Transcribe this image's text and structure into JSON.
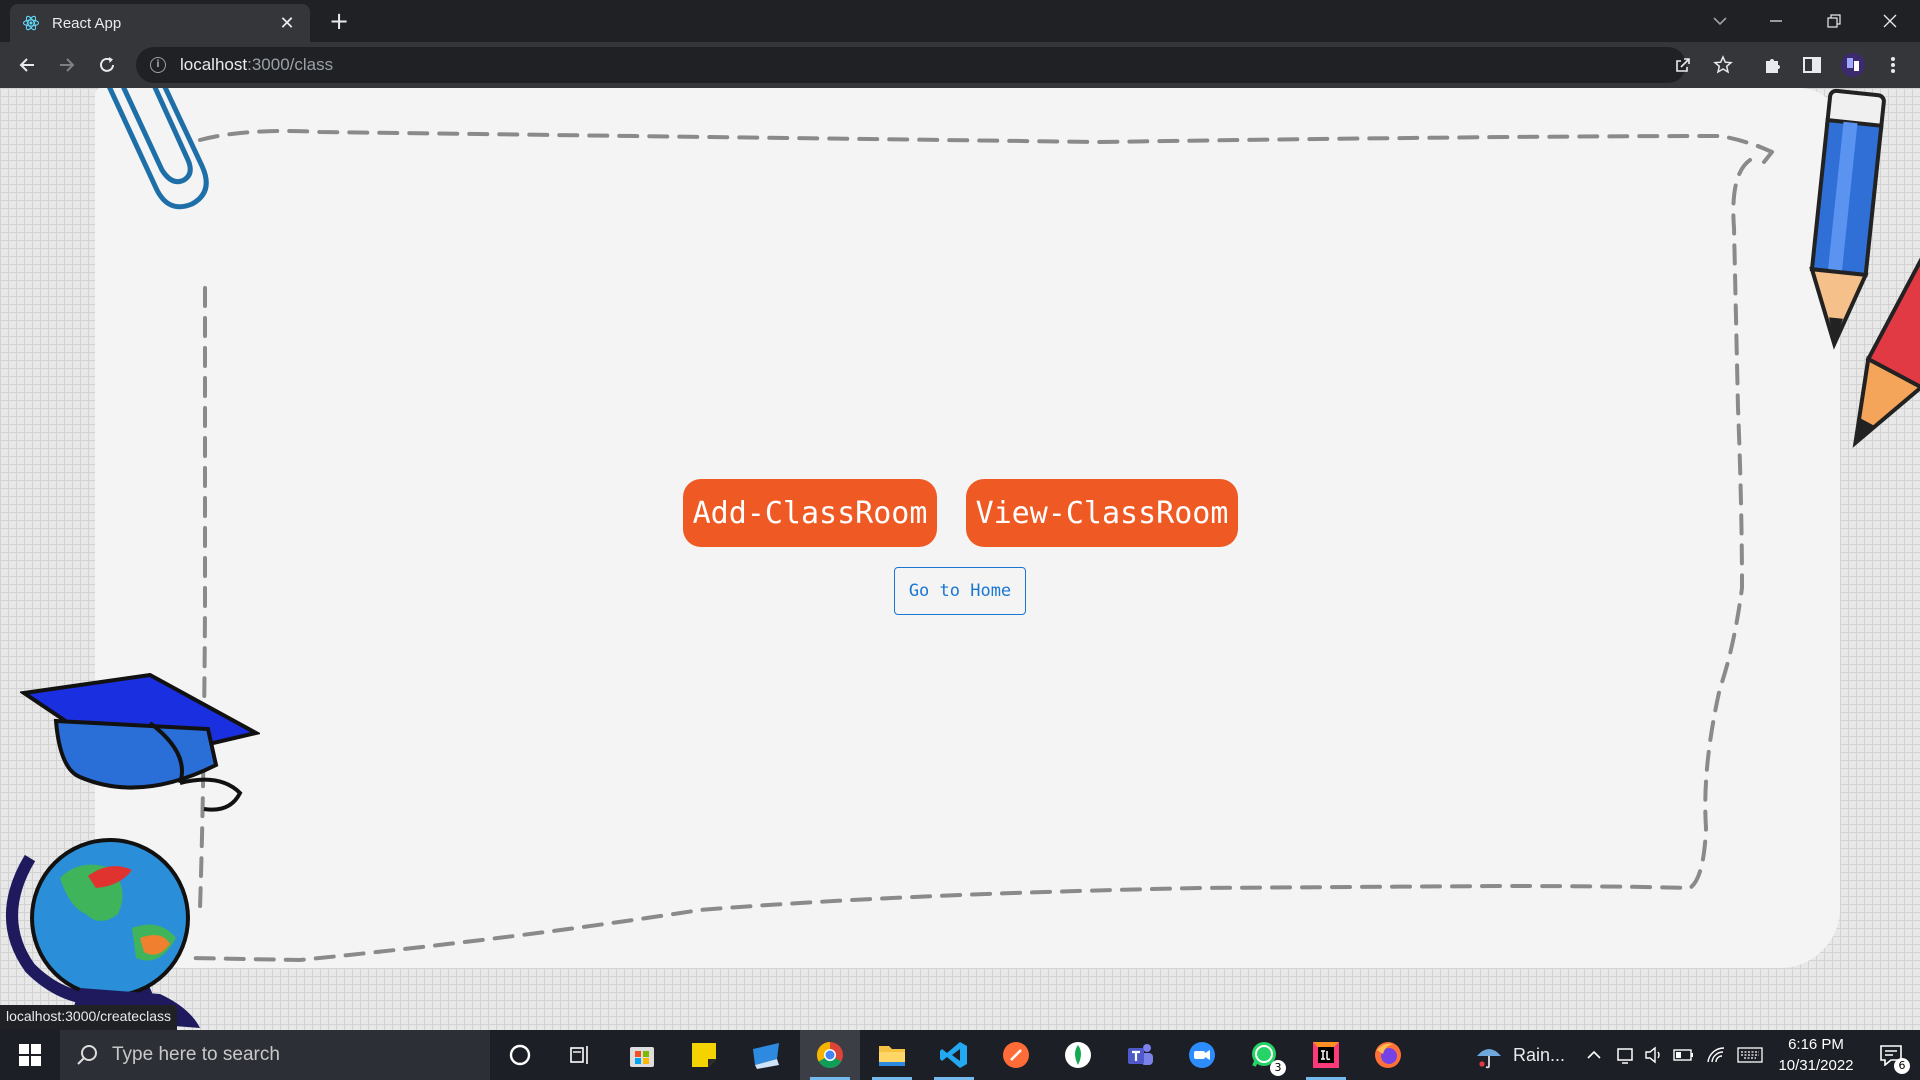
{
  "browser": {
    "tab": {
      "title": "React App",
      "favicon": "react-icon"
    },
    "address": {
      "host": "localhost",
      "path": ":3000/class",
      "info_icon": "i"
    },
    "status_url": "localhost:3000/createclass"
  },
  "page": {
    "buttons": {
      "add": "Add-ClassRoom",
      "view": "View-ClassRoom",
      "home": "Go to Home"
    },
    "colors": {
      "accent": "#ef5a24",
      "link": "#1976d2",
      "paper": "#f4f4f4"
    }
  },
  "taskbar": {
    "search_placeholder": "Type here to search",
    "apps": [
      "cortana-icon",
      "task-view-icon",
      "store-icon",
      "sticky-notes-icon",
      "remote-icon",
      "chrome-icon",
      "file-explorer-icon",
      "vscode-icon",
      "postman-icon",
      "mongodb-icon",
      "teams-icon",
      "zoom-icon",
      "whatsapp-icon",
      "intellij-icon",
      "firefox-icon"
    ],
    "whatsapp_badge": "3",
    "weather": "Rain...",
    "clock": {
      "time": "6:16 PM",
      "date": "10/31/2022"
    },
    "notifications": "6"
  }
}
